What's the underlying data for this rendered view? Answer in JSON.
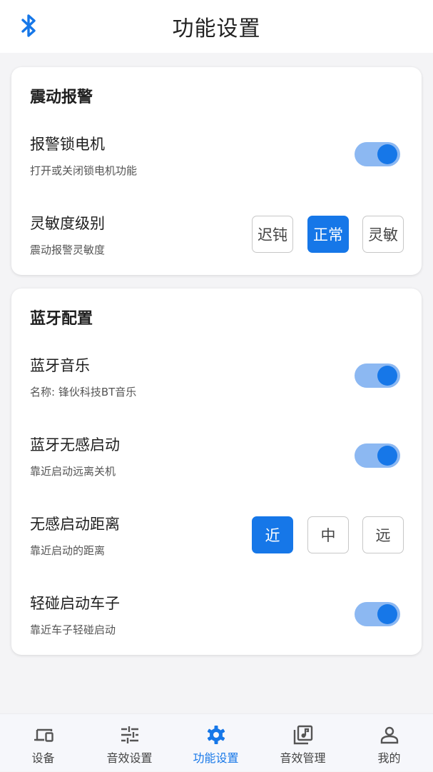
{
  "header": {
    "title": "功能设置",
    "bt_icon": "bluetooth-icon"
  },
  "vibration_card": {
    "title": "震动报警",
    "lock_motor": {
      "label": "报警锁电机",
      "desc": "打开或关闭锁电机功能",
      "on": true
    },
    "sensitivity": {
      "label": "灵敏度级别",
      "desc": "震动报警灵敏度",
      "options": [
        "迟钝",
        "正常",
        "灵敏"
      ],
      "selected": "正常"
    }
  },
  "bluetooth_card": {
    "title": "蓝牙配置",
    "music": {
      "label": "蓝牙音乐",
      "desc": "名称: 锋伙科技BT音乐",
      "on": true
    },
    "keyless": {
      "label": "蓝牙无感启动",
      "desc": "靠近启动远离关机",
      "on": true
    },
    "distance": {
      "label": "无感启动距离",
      "desc": "靠近启动的距离",
      "options": [
        "近",
        "中",
        "远"
      ],
      "selected": "近"
    },
    "touch_start": {
      "label": "轻碰启动车子",
      "desc": "靠近车子轻碰启动",
      "on": true
    }
  },
  "tabbar": {
    "items": [
      {
        "label": "设备",
        "icon": "devices-icon"
      },
      {
        "label": "音效设置",
        "icon": "sliders-icon"
      },
      {
        "label": "功能设置",
        "icon": "gear-icon",
        "active": true
      },
      {
        "label": "音效管理",
        "icon": "music-library-icon"
      },
      {
        "label": "我的",
        "icon": "person-icon"
      }
    ]
  },
  "colors": {
    "accent": "#1677e8",
    "toggle_track": "#8cb8f2"
  }
}
